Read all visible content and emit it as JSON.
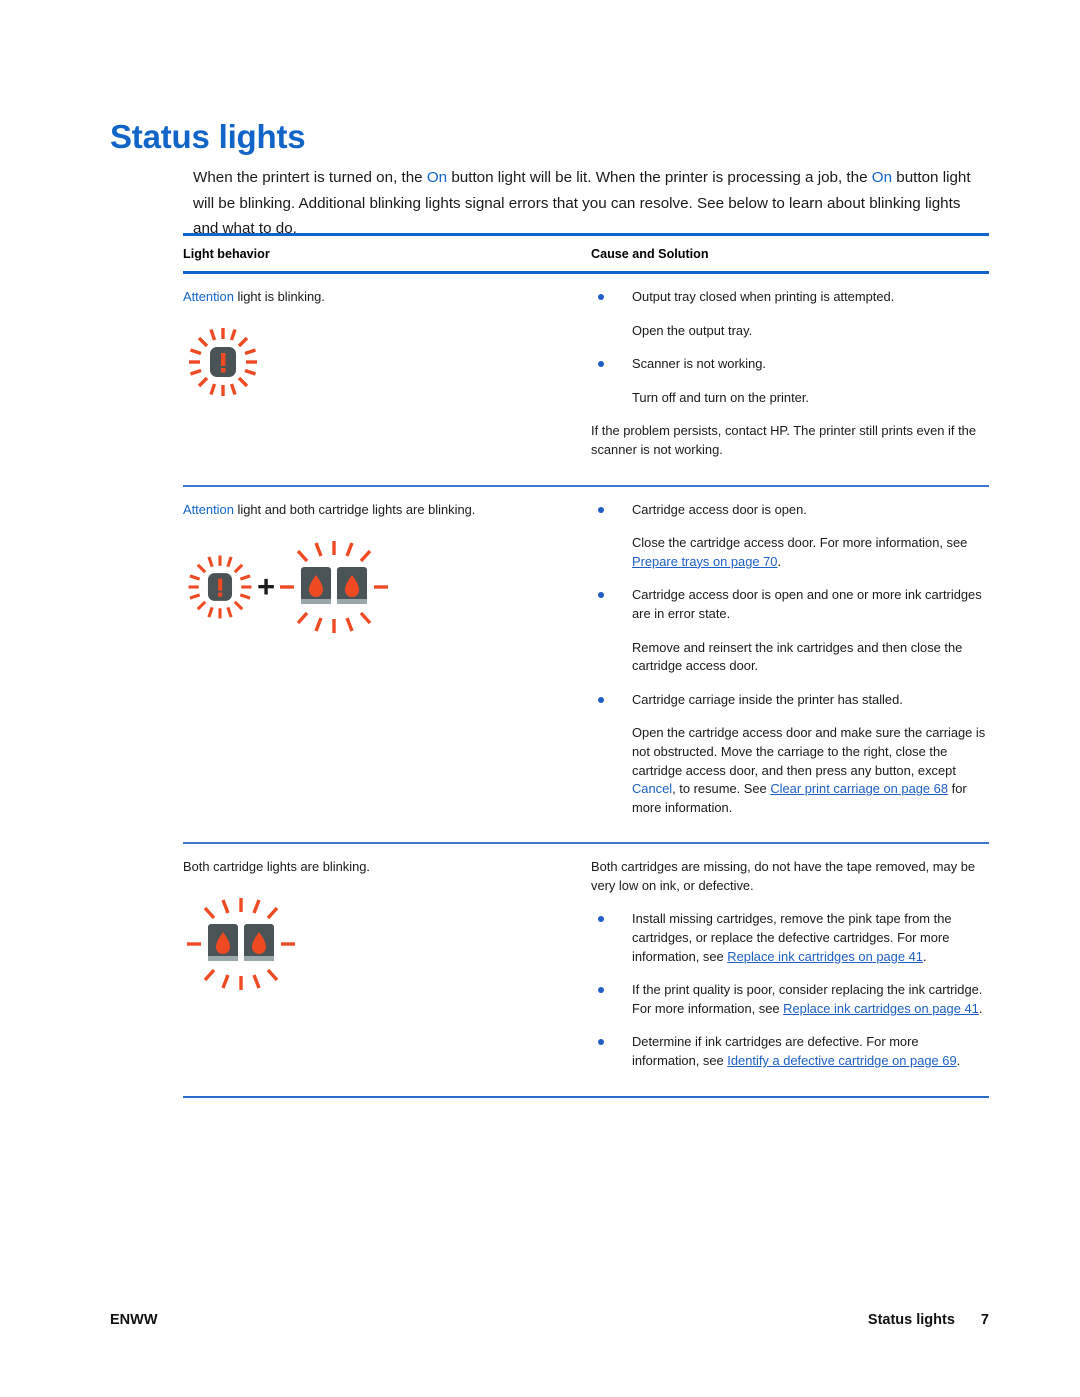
{
  "document": {
    "title": "Status lights",
    "intro_parts": [
      {
        "t": "When the printert is turned on, the ",
        "style": "normal"
      },
      {
        "t": "On",
        "style": "kw"
      },
      {
        "t": " button light will be lit. When the printer is processing a job, the ",
        "style": "normal"
      },
      {
        "t": "On",
        "style": "kw"
      },
      {
        "t": " button light will be blinking. Additional blinking lights signal errors that you can resolve. See below to learn about blinking lights and what to do.",
        "style": "normal"
      }
    ]
  },
  "table": {
    "headers": {
      "light_behavior": "Light behavior",
      "cause_and_solution": "Cause and Solution"
    },
    "rows": [
      {
        "behavior_keyword": "Attention",
        "behavior_rest": " light is blinking.",
        "icon": "attention-light-blinking-icon",
        "solutions": [
          {
            "kind": "bullet",
            "text": "Output tray closed when printing is attempted."
          },
          {
            "kind": "sub",
            "text": "Open the output tray."
          },
          {
            "kind": "bullet",
            "text": "Scanner is not working."
          },
          {
            "kind": "sub",
            "text": "Turn off and turn on the printer."
          },
          {
            "kind": "plain",
            "text": "If the problem persists, contact HP. The printer still prints even if the scanner is not working."
          }
        ]
      },
      {
        "behavior_keyword": "Attention",
        "behavior_rest": " light and both cartridge lights are blinking.",
        "icon": "attention-plus-cartridge-lights-icon",
        "solutions": [
          {
            "kind": "bullet",
            "text": "Cartridge access door is open."
          },
          {
            "kind": "sub",
            "segments": [
              {
                "t": "Close the cartridge access door. For more information, see ",
                "style": "normal"
              },
              {
                "t": "Prepare trays on page 70",
                "style": "link"
              },
              {
                "t": ".",
                "style": "normal"
              }
            ]
          },
          {
            "kind": "bullet",
            "text": "Cartridge access door is open and one or more ink cartridges are in error state."
          },
          {
            "kind": "sub",
            "text": "Remove and reinsert the ink cartridges and then close the cartridge access door."
          },
          {
            "kind": "bullet",
            "text": "Cartridge carriage inside the printer has stalled."
          },
          {
            "kind": "sub",
            "segments": [
              {
                "t": "Open the cartridge access door and make sure the carriage is not obstructed. Move the carriage to the right, close the cartridge access door, and then press any button, except ",
                "style": "normal"
              },
              {
                "t": "Cancel",
                "style": "kw"
              },
              {
                "t": ", to resume. See ",
                "style": "normal"
              },
              {
                "t": "Clear print carriage on page 68",
                "style": "link"
              },
              {
                "t": " for more information.",
                "style": "normal"
              }
            ]
          }
        ]
      },
      {
        "behavior_keyword": "",
        "behavior_rest": "Both cartridge lights are blinking.",
        "icon": "both-cartridge-lights-blinking-icon",
        "solutions": [
          {
            "kind": "plain",
            "text": "Both cartridges are missing, do not have the tape removed, may be very low on ink, or defective."
          },
          {
            "kind": "bullet",
            "segments": [
              {
                "t": "Install missing cartridges, remove the pink tape from the cartridges, or replace the defective cartridges. For more information, see ",
                "style": "normal"
              },
              {
                "t": "Replace ink cartridges on page 41",
                "style": "link"
              },
              {
                "t": ".",
                "style": "normal"
              }
            ]
          },
          {
            "kind": "bullet",
            "segments": [
              {
                "t": "If the print quality is poor, consider replacing the ink cartridge. For more information, see ",
                "style": "normal"
              },
              {
                "t": "Replace ink cartridges on page 41",
                "style": "link"
              },
              {
                "t": ".",
                "style": "normal"
              }
            ]
          },
          {
            "kind": "bullet",
            "segments": [
              {
                "t": "Determine if ink cartridges are defective. For more information, see ",
                "style": "normal"
              },
              {
                "t": "Identify a defective cartridge on page 69",
                "style": "link"
              },
              {
                "t": ".",
                "style": "normal"
              }
            ]
          }
        ]
      }
    ]
  },
  "footer": {
    "left": "ENWW",
    "section": "Status lights",
    "page_number": "7"
  },
  "colors": {
    "heading_blue": "#1265C8",
    "rule_blue": "#1265C8",
    "link_blue": "#1D5FC4",
    "icon_orange": "#F04A23",
    "icon_body": "#4A5356"
  }
}
